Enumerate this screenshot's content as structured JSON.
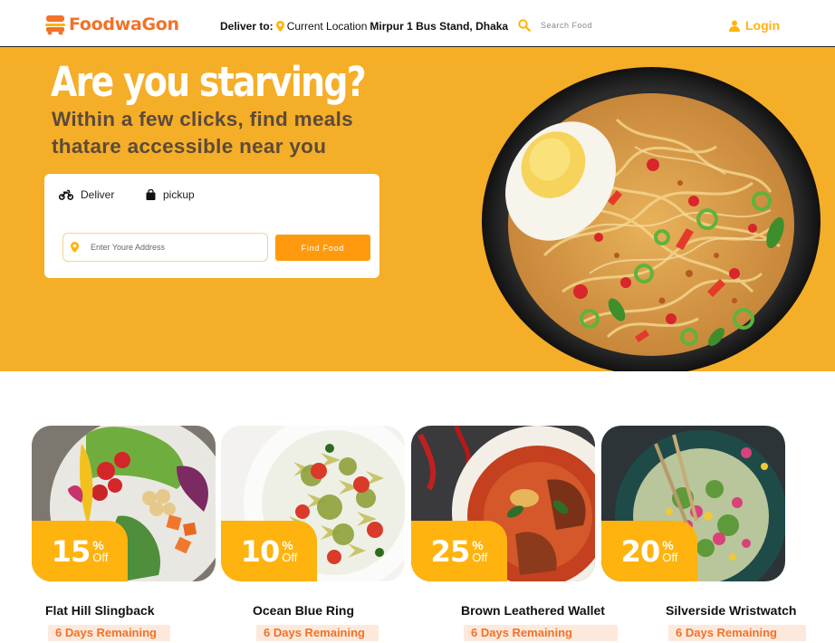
{
  "header": {
    "brand": "FoodwaGon",
    "deliver_label": "Deliver to:",
    "location_prefix": "Current Location",
    "location": "Mirpur 1 Bus Stand, Dhaka",
    "search_placeholder": "Search Food",
    "login_label": "Login"
  },
  "hero": {
    "title": "Are you starving?",
    "subtitle": "Within a few clicks, find meals thatare accessible near you",
    "tabs": [
      {
        "label": "Deliver",
        "icon": "motorbike-icon"
      },
      {
        "label": "pickup",
        "icon": "shopping-bag-icon"
      }
    ],
    "address_placeholder": "Enter Youre Address",
    "find_button": "Find Food"
  },
  "deals": [
    {
      "discount": "15",
      "percent": "%",
      "off": "Off",
      "name": "Flat Hill Slingback",
      "remaining": "6 Days Remaining"
    },
    {
      "discount": "10",
      "percent": "%",
      "off": "Off",
      "name": "Ocean Blue Ring",
      "remaining": "6 Days Remaining"
    },
    {
      "discount": "25",
      "percent": "%",
      "off": "Off",
      "name": "Brown Leathered Wallet",
      "remaining": "6 Days Remaining"
    },
    {
      "discount": "20",
      "percent": "%",
      "off": "Off",
      "name": "Silverside Wristwatch",
      "remaining": "6 Days Remaining"
    }
  ],
  "colors": {
    "brand": "#f17228",
    "accent": "#ffb30e",
    "hero_bg": "#f5ae28",
    "button": "#ff9a0e"
  }
}
